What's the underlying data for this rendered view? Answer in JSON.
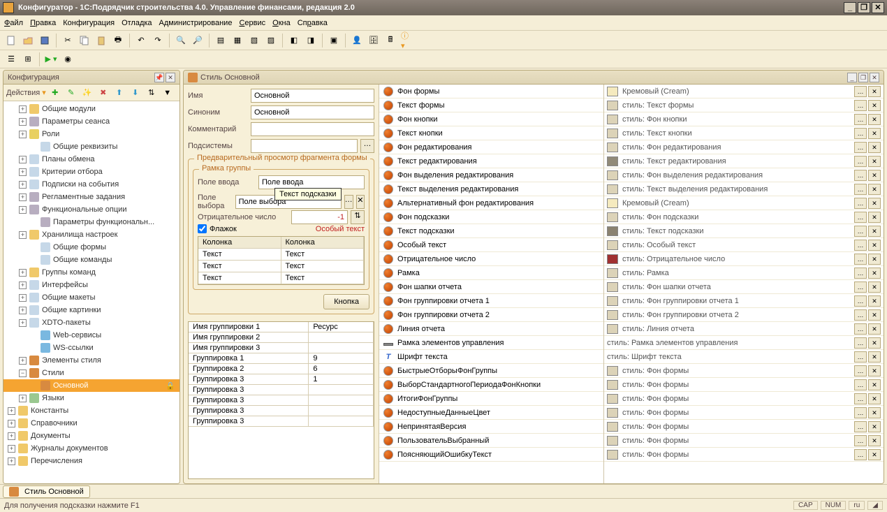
{
  "window": {
    "title": "Конфигуратор - 1С:Подрядчик строительства 4.0. Управление финансами, редакция 2.0"
  },
  "menu": [
    "Файл",
    "Правка",
    "Конфигурация",
    "Отладка",
    "Администрирование",
    "Сервис",
    "Окна",
    "Справка"
  ],
  "config_panel": {
    "title": "Конфигурация",
    "actions": "Действия"
  },
  "tree": [
    {
      "indent": 1,
      "exp": "+",
      "icon": "ic-folder",
      "label": "Общие модули"
    },
    {
      "indent": 1,
      "exp": "+",
      "icon": "ic-gear",
      "label": "Параметры сеанса"
    },
    {
      "indent": 1,
      "exp": "+",
      "icon": "ic-key",
      "label": "Роли"
    },
    {
      "indent": 2,
      "exp": "",
      "icon": "ic-page",
      "label": "Общие реквизиты"
    },
    {
      "indent": 1,
      "exp": "+",
      "icon": "ic-page",
      "label": "Планы обмена"
    },
    {
      "indent": 1,
      "exp": "+",
      "icon": "ic-page",
      "label": "Критерии отбора"
    },
    {
      "indent": 1,
      "exp": "+",
      "icon": "ic-page",
      "label": "Подписки на события"
    },
    {
      "indent": 1,
      "exp": "+",
      "icon": "ic-gear",
      "label": "Регламентные задания"
    },
    {
      "indent": 1,
      "exp": "+",
      "icon": "ic-gear",
      "label": "Функциональные опции"
    },
    {
      "indent": 2,
      "exp": "",
      "icon": "ic-gear",
      "label": "Параметры функциональн..."
    },
    {
      "indent": 1,
      "exp": "+",
      "icon": "ic-folder",
      "label": "Хранилища настроек"
    },
    {
      "indent": 2,
      "exp": "",
      "icon": "ic-page",
      "label": "Общие формы"
    },
    {
      "indent": 2,
      "exp": "",
      "icon": "ic-page",
      "label": "Общие команды"
    },
    {
      "indent": 1,
      "exp": "+",
      "icon": "ic-folder",
      "label": "Группы команд"
    },
    {
      "indent": 1,
      "exp": "+",
      "icon": "ic-page",
      "label": "Интерфейсы"
    },
    {
      "indent": 1,
      "exp": "+",
      "icon": "ic-page",
      "label": "Общие макеты"
    },
    {
      "indent": 1,
      "exp": "+",
      "icon": "ic-page",
      "label": "Общие картинки"
    },
    {
      "indent": 1,
      "exp": "+",
      "icon": "ic-page",
      "label": "XDTO-пакеты"
    },
    {
      "indent": 2,
      "exp": "",
      "icon": "ic-globe",
      "label": "Web-сервисы"
    },
    {
      "indent": 2,
      "exp": "",
      "icon": "ic-globe",
      "label": "WS-ссылки"
    },
    {
      "indent": 1,
      "exp": "+",
      "icon": "ic-style",
      "label": "Элементы стиля"
    },
    {
      "indent": 1,
      "exp": "−",
      "icon": "ic-style",
      "label": "Стили"
    },
    {
      "indent": 2,
      "exp": "",
      "icon": "ic-style",
      "label": "Основной",
      "selected": true,
      "lock": true
    },
    {
      "indent": 1,
      "exp": "+",
      "icon": "ic-lang",
      "label": "Языки"
    },
    {
      "indent": 0,
      "exp": "+",
      "icon": "ic-folder",
      "label": "Константы"
    },
    {
      "indent": 0,
      "exp": "+",
      "icon": "ic-folder",
      "label": "Справочники"
    },
    {
      "indent": 0,
      "exp": "+",
      "icon": "ic-folder",
      "label": "Документы"
    },
    {
      "indent": 0,
      "exp": "+",
      "icon": "ic-folder",
      "label": "Журналы документов"
    },
    {
      "indent": 0,
      "exp": "+",
      "icon": "ic-folder",
      "label": "Перечисления"
    }
  ],
  "style_panel": {
    "title": "Стиль Основной"
  },
  "form": {
    "name_label": "Имя",
    "name_value": "Основной",
    "syn_label": "Синоним",
    "syn_value": "Основной",
    "comment_label": "Комментарий",
    "comment_value": "",
    "subsys_label": "Подсистемы",
    "subsys_value": ""
  },
  "preview": {
    "legend": "Предварительный просмотр фрагмента формы",
    "frame_legend": "Рамка группы",
    "input_label": "Поле ввода",
    "input_value": "Поле ввода",
    "select_label": "Поле выбора",
    "select_value": "Поле выбора",
    "tooltip": "Текст подсказки",
    "neg_label": "Отрицательное число",
    "neg_value": "-1",
    "flag_label": "Флажок",
    "special_text": "Особый текст",
    "col_header": "Колонка",
    "cell_text": "Текст",
    "button_label": "Кнопка"
  },
  "grid_rows": [
    {
      "c1": "Имя группировки 1",
      "c2": "Ресурс"
    },
    {
      "c1": "Имя группировки 2",
      "c2": ""
    },
    {
      "c1": "Имя группировки 3",
      "c2": ""
    },
    {
      "c1": "Группировка 1",
      "c2": "9"
    },
    {
      "c1": "Группировка 2",
      "c2": "6"
    },
    {
      "c1": "Группировка 3",
      "c2": "1"
    },
    {
      "c1": "Группировка 3",
      "c2": ""
    },
    {
      "c1": "Группировка 3",
      "c2": ""
    },
    {
      "c1": "Группировка 3",
      "c2": ""
    },
    {
      "c1": "Группировка 3",
      "c2": ""
    }
  ],
  "style_items": [
    {
      "label": "Фон формы"
    },
    {
      "label": "Текст формы"
    },
    {
      "label": "Фон кнопки"
    },
    {
      "label": "Текст кнопки"
    },
    {
      "label": "Фон редактирования"
    },
    {
      "label": "Текст редактирования"
    },
    {
      "label": "Фон выделения редактирования"
    },
    {
      "label": "Текст выделения редактирования"
    },
    {
      "label": "Альтернативный фон редактирования"
    },
    {
      "label": "Фон подсказки"
    },
    {
      "label": "Текст подсказки"
    },
    {
      "label": "Особый текст"
    },
    {
      "label": "Отрицательное число"
    },
    {
      "label": "Рамка"
    },
    {
      "label": "Фон шапки отчета"
    },
    {
      "label": "Фон группировки отчета 1"
    },
    {
      "label": "Фон группировки отчета 2"
    },
    {
      "label": "Линия отчета"
    },
    {
      "label": "Рамка элементов управления",
      "type": "line"
    },
    {
      "label": "Шрифт текста",
      "type": "font"
    },
    {
      "label": "БыстрыеОтборыФонГруппы"
    },
    {
      "label": "ВыборСтандартногоПериодаФонКнопки"
    },
    {
      "label": "ИтогиФонГруппы"
    },
    {
      "label": "НедоступныеДанныеЦвет"
    },
    {
      "label": "НепринятаяВерсия"
    },
    {
      "label": "ПользовательВыбранный"
    },
    {
      "label": "ПоясняющийОшибкуТекст"
    }
  ],
  "value_items": [
    {
      "color": "#f5eabe",
      "label": "Кремовый (Cream)"
    },
    {
      "color": "#dcd3b8",
      "label": "стиль: Текст формы"
    },
    {
      "color": "#dcd3b8",
      "label": "стиль: Фон кнопки"
    },
    {
      "color": "#dcd3b8",
      "label": "стиль: Текст кнопки"
    },
    {
      "color": "#dcd3b8",
      "label": "стиль: Фон редактирования"
    },
    {
      "color": "#918a78",
      "label": "стиль: Текст редактирования"
    },
    {
      "color": "#dcd3b8",
      "label": "стиль: Фон выделения редактирования"
    },
    {
      "color": "#dcd3b8",
      "label": "стиль: Текст выделения редактирования"
    },
    {
      "color": "#f5eabe",
      "label": "Кремовый (Cream)"
    },
    {
      "color": "#dcd3b8",
      "label": "стиль: Фон подсказки"
    },
    {
      "color": "#8a8270",
      "label": "стиль: Текст подсказки"
    },
    {
      "color": "#dcd3b8",
      "label": "стиль: Особый текст"
    },
    {
      "color": "#a03030",
      "label": "стиль: Отрицательное число"
    },
    {
      "color": "#dcd3b8",
      "label": "стиль: Рамка"
    },
    {
      "color": "#dcd3b8",
      "label": "стиль: Фон шапки отчета"
    },
    {
      "color": "#dcd3b8",
      "label": "стиль: Фон группировки отчета 1"
    },
    {
      "color": "#dcd3b8",
      "label": "стиль: Фон группировки отчета 2"
    },
    {
      "color": "#dcd3b8",
      "label": "стиль: Линия отчета"
    },
    {
      "color": "",
      "label": "стиль: Рамка элементов управления",
      "noclr": true
    },
    {
      "color": "",
      "label": "стиль: Шрифт текста",
      "noclr": true
    },
    {
      "color": "#dcd3b8",
      "label": "стиль: Фон формы"
    },
    {
      "color": "#dcd3b8",
      "label": "стиль: Фон формы"
    },
    {
      "color": "#dcd3b8",
      "label": "стиль: Фон формы"
    },
    {
      "color": "#dcd3b8",
      "label": "стиль: Фон формы"
    },
    {
      "color": "#dcd3b8",
      "label": "стиль: Фон формы"
    },
    {
      "color": "#dcd3b8",
      "label": "стиль: Фон формы"
    },
    {
      "color": "#dcd3b8",
      "label": "стиль: Фон формы"
    }
  ],
  "taskbar": {
    "tab": "Стиль Основной"
  },
  "status": {
    "hint": "Для получения подсказки нажмите F1",
    "cap": "CAP",
    "num": "NUM",
    "lang": "ru"
  }
}
